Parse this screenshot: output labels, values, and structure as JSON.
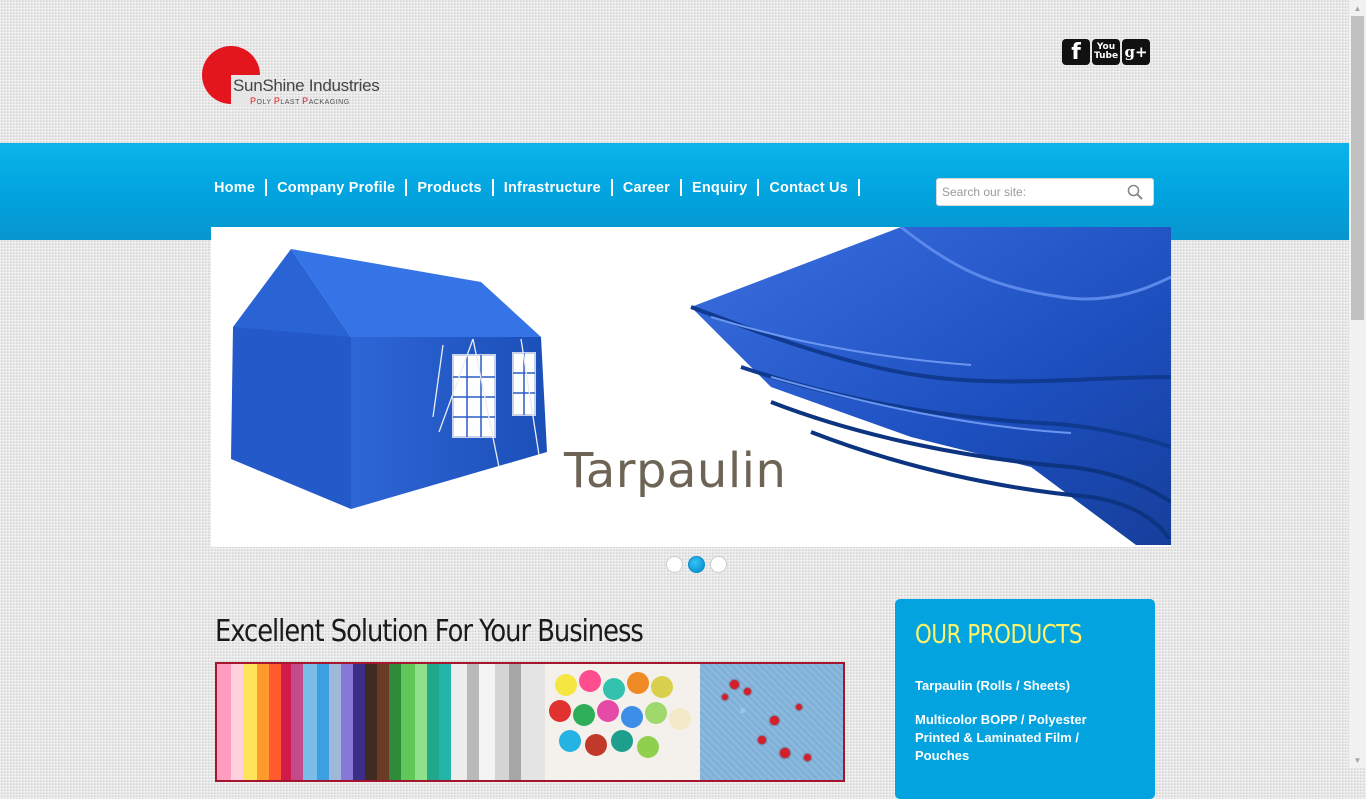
{
  "brand": {
    "name": "SunShine Industries",
    "tagline": "Poly Plast Packaging",
    "accent_red": "#e3161e",
    "accent_blue": "#02a3de",
    "accent_yellow": "#fff36b"
  },
  "social": [
    {
      "name": "facebook",
      "icon": "facebook-icon",
      "glyph": "f"
    },
    {
      "name": "youtube",
      "icon": "youtube-icon",
      "glyph_top": "You",
      "glyph_bottom": "Tube"
    },
    {
      "name": "google-plus",
      "icon": "google-plus-icon",
      "glyph": "g+"
    }
  ],
  "nav": {
    "items": [
      {
        "label": "Home"
      },
      {
        "label": "Company Profile"
      },
      {
        "label": "Products"
      },
      {
        "label": "Infrastructure"
      },
      {
        "label": "Career"
      },
      {
        "label": "Enquiry"
      },
      {
        "label": "Contact Us"
      }
    ]
  },
  "search": {
    "placeholder": "Search our site:",
    "value": ""
  },
  "slider": {
    "caption": "Tarpaulin",
    "slide_count": 3,
    "active_slide": 2
  },
  "main": {
    "headline": "Excellent Solution For Your Business"
  },
  "sidebar": {
    "title": "OUR PRODUCTS",
    "products": [
      {
        "label": "Tarpaulin (Rolls / Sheets)"
      },
      {
        "label": "Multicolor BOPP / Polyester Printed & Laminated Film / Pouches"
      }
    ]
  }
}
